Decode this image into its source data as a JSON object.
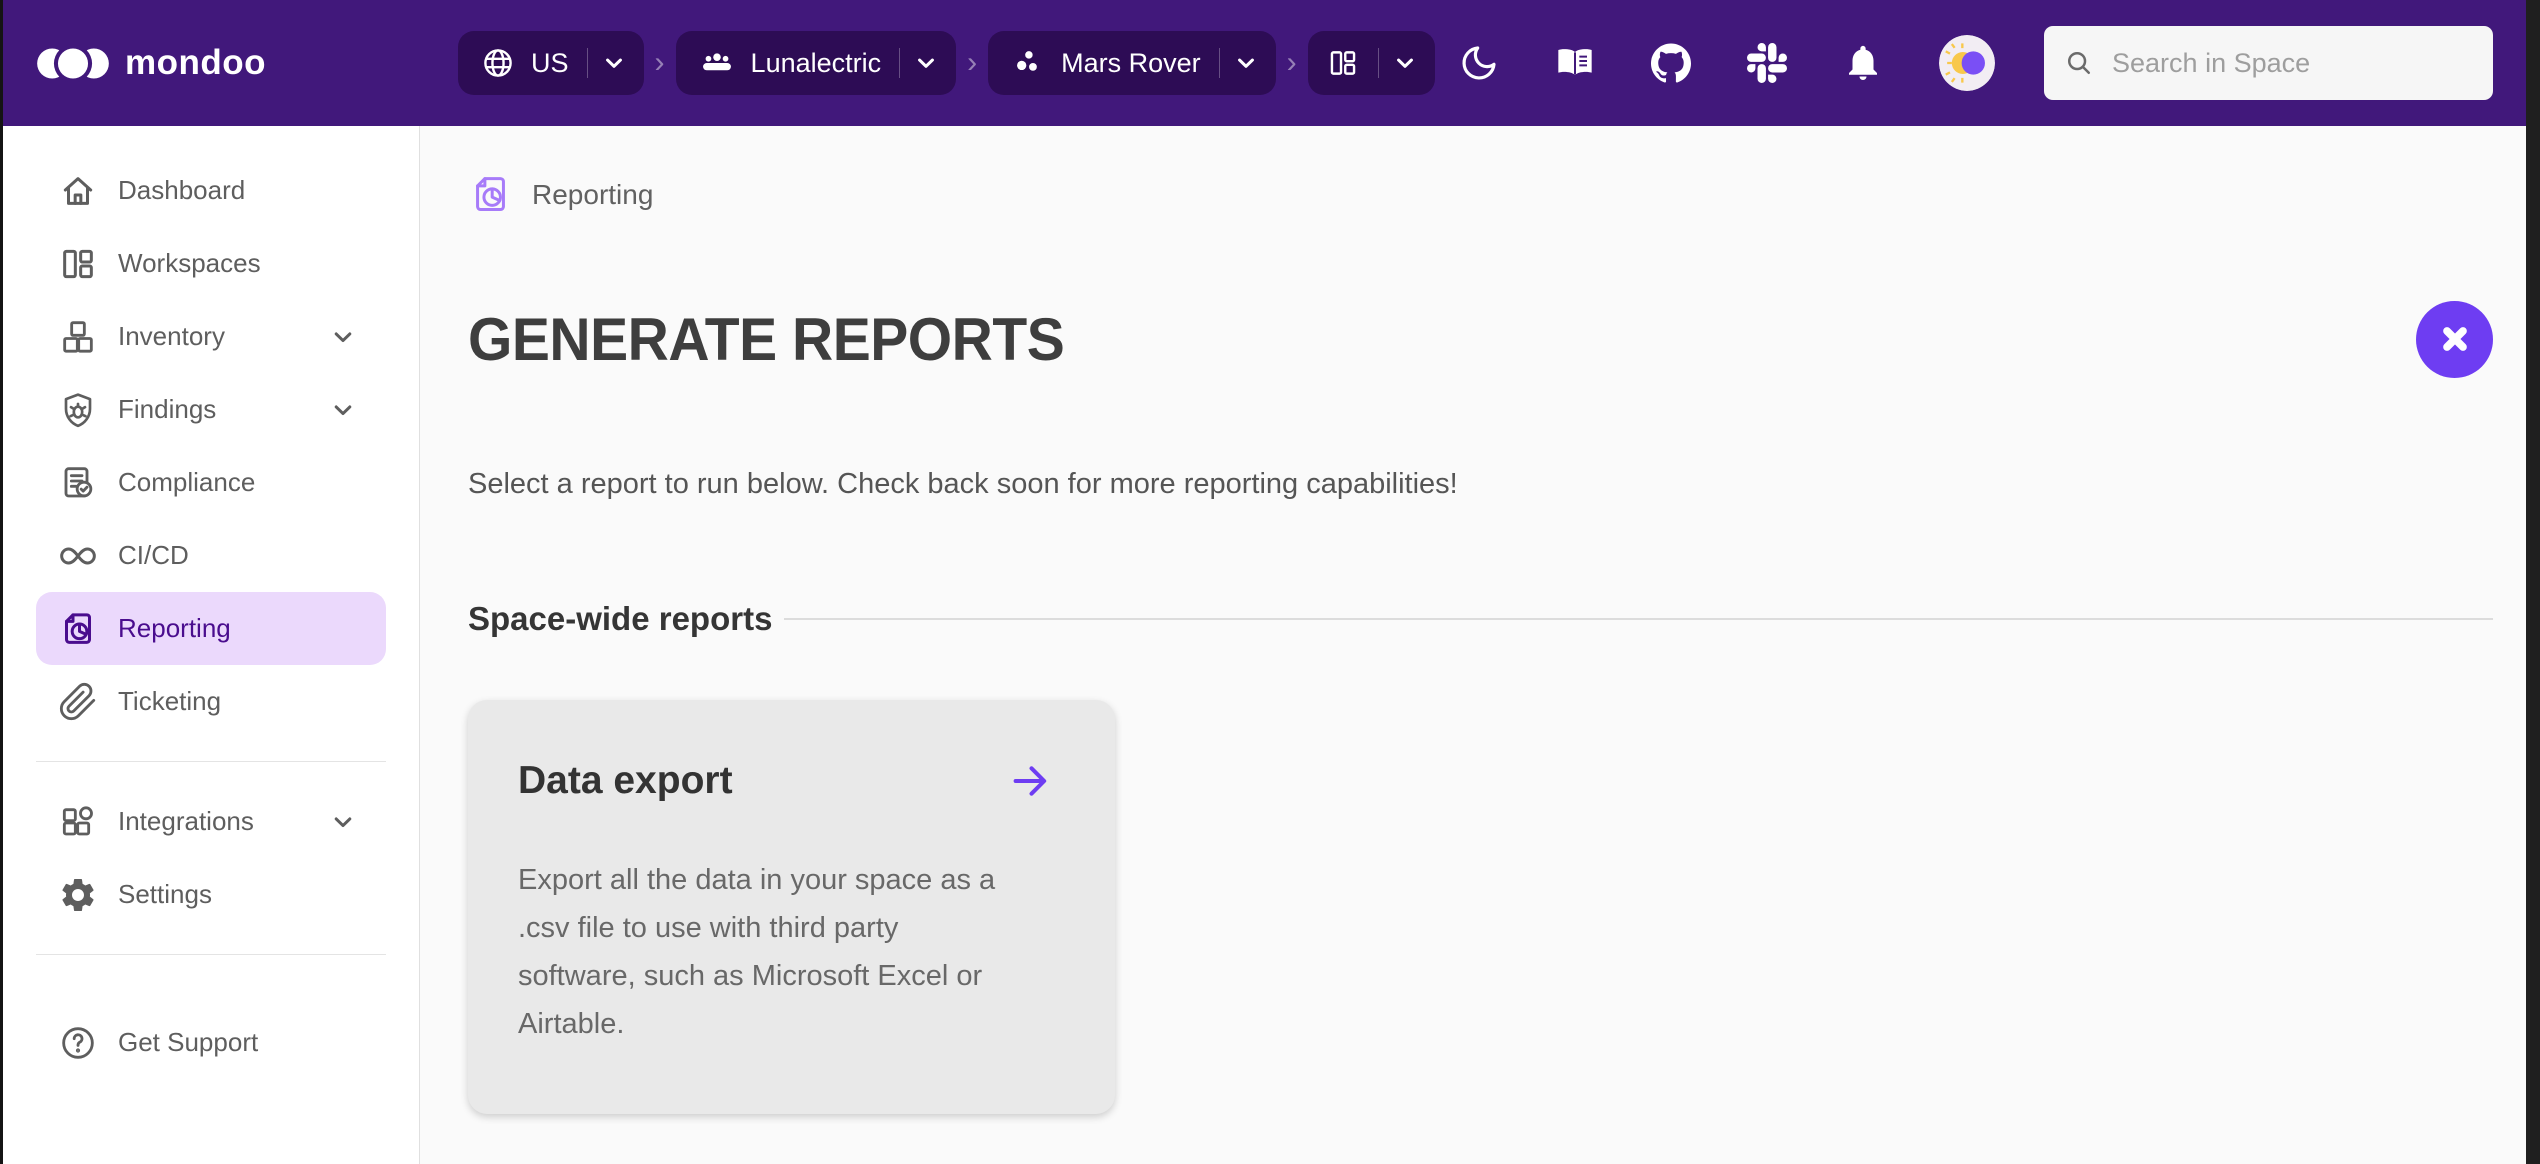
{
  "header": {
    "brand": "mondoo",
    "region_label": "US",
    "org_label": "Lunalectric",
    "space_label": "Mars Rover",
    "search_placeholder": "Search in Space"
  },
  "sidebar": {
    "items": [
      {
        "label": "Dashboard"
      },
      {
        "label": "Workspaces"
      },
      {
        "label": "Inventory"
      },
      {
        "label": "Findings"
      },
      {
        "label": "Compliance"
      },
      {
        "label": "CI/CD"
      },
      {
        "label": "Reporting"
      },
      {
        "label": "Ticketing"
      },
      {
        "label": "Integrations"
      },
      {
        "label": "Settings"
      },
      {
        "label": "Get Support"
      }
    ]
  },
  "main": {
    "breadcrumb_label": "Reporting",
    "title": "GENERATE REPORTS",
    "description": "Select a report to run below. Check back soon for more reporting capabilities!",
    "section_title": "Space-wide reports",
    "cards": [
      {
        "title": "Data export",
        "description": "Export all the data in your space as a .csv file to use with third party software, such as Microsoft Excel or Airtable."
      }
    ]
  },
  "colors": {
    "header_bg": "#41187B",
    "pill_bg": "#2D0C55",
    "accent_purple": "#6E3DF2",
    "selected_item_bg": "#EBD9FC",
    "selected_item_text": "#4A0D8E",
    "breadcrumb_icon_purple": "#A77BF9",
    "main_bg": "#FAFAFA",
    "card_bg": "#E9E9E9"
  }
}
